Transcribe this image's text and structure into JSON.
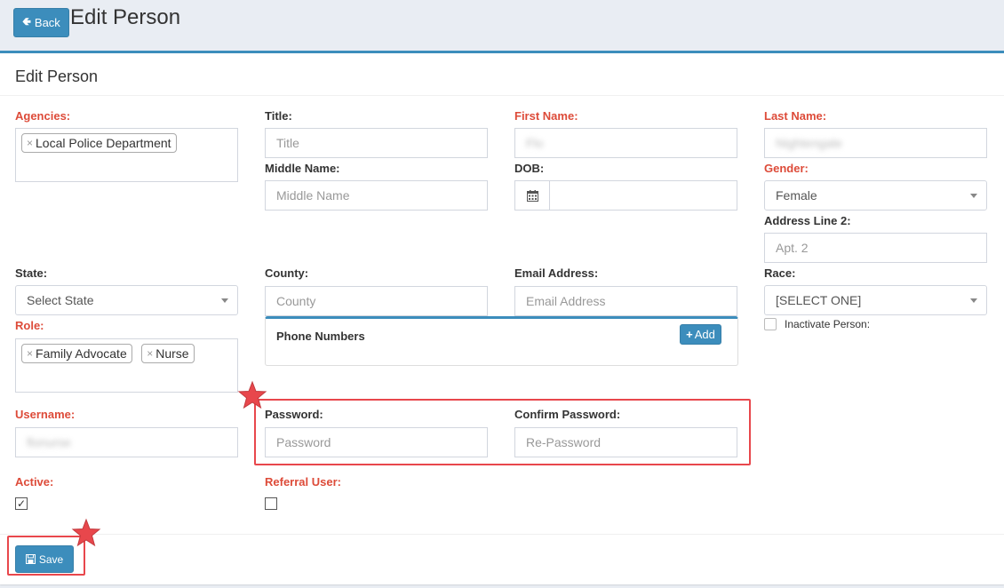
{
  "header": {
    "back_label": "Back",
    "page_title": "Edit Person"
  },
  "box": {
    "title": "Edit Person"
  },
  "fields": {
    "agencies": {
      "label": "Agencies:",
      "tags": [
        "Local Police Department"
      ]
    },
    "title": {
      "label": "Title:",
      "placeholder": "Title"
    },
    "first_name": {
      "label": "First Name:",
      "value": "Flo"
    },
    "last_name": {
      "label": "Last Name:",
      "value": "Nightengale"
    },
    "middle_name": {
      "label": "Middle Name:",
      "placeholder": "Middle Name"
    },
    "dob": {
      "label": "DOB:",
      "value": ""
    },
    "gender": {
      "label": "Gender:",
      "value": "Female"
    },
    "address_line_2": {
      "label": "Address Line 2:",
      "placeholder": "Apt. 2"
    },
    "state": {
      "label": "State:",
      "value": "Select State"
    },
    "county": {
      "label": "County:",
      "placeholder": "County"
    },
    "email": {
      "label": "Email Address:",
      "placeholder": "Email Address"
    },
    "race": {
      "label": "Race:",
      "value": "[SELECT ONE]"
    },
    "inactivate": {
      "label": "Inactivate Person:",
      "checked": false
    },
    "role": {
      "label": "Role:",
      "tags": [
        "Family Advocate",
        "Nurse"
      ]
    },
    "phone_numbers": {
      "title": "Phone Numbers",
      "add_label": "Add"
    },
    "username": {
      "label": "Username:",
      "value": "flonurse"
    },
    "password": {
      "label": "Password:",
      "placeholder": "Password"
    },
    "confirm_password": {
      "label": "Confirm Password:",
      "placeholder": "Re-Password"
    },
    "active": {
      "label": "Active:",
      "checked": true
    },
    "referral_user": {
      "label": "Referral User:",
      "checked": false
    }
  },
  "footer": {
    "save_label": "Save"
  },
  "colors": {
    "primary": "#3c8dbc",
    "required_label": "#dd4b39",
    "annotation": "#e8474c"
  }
}
